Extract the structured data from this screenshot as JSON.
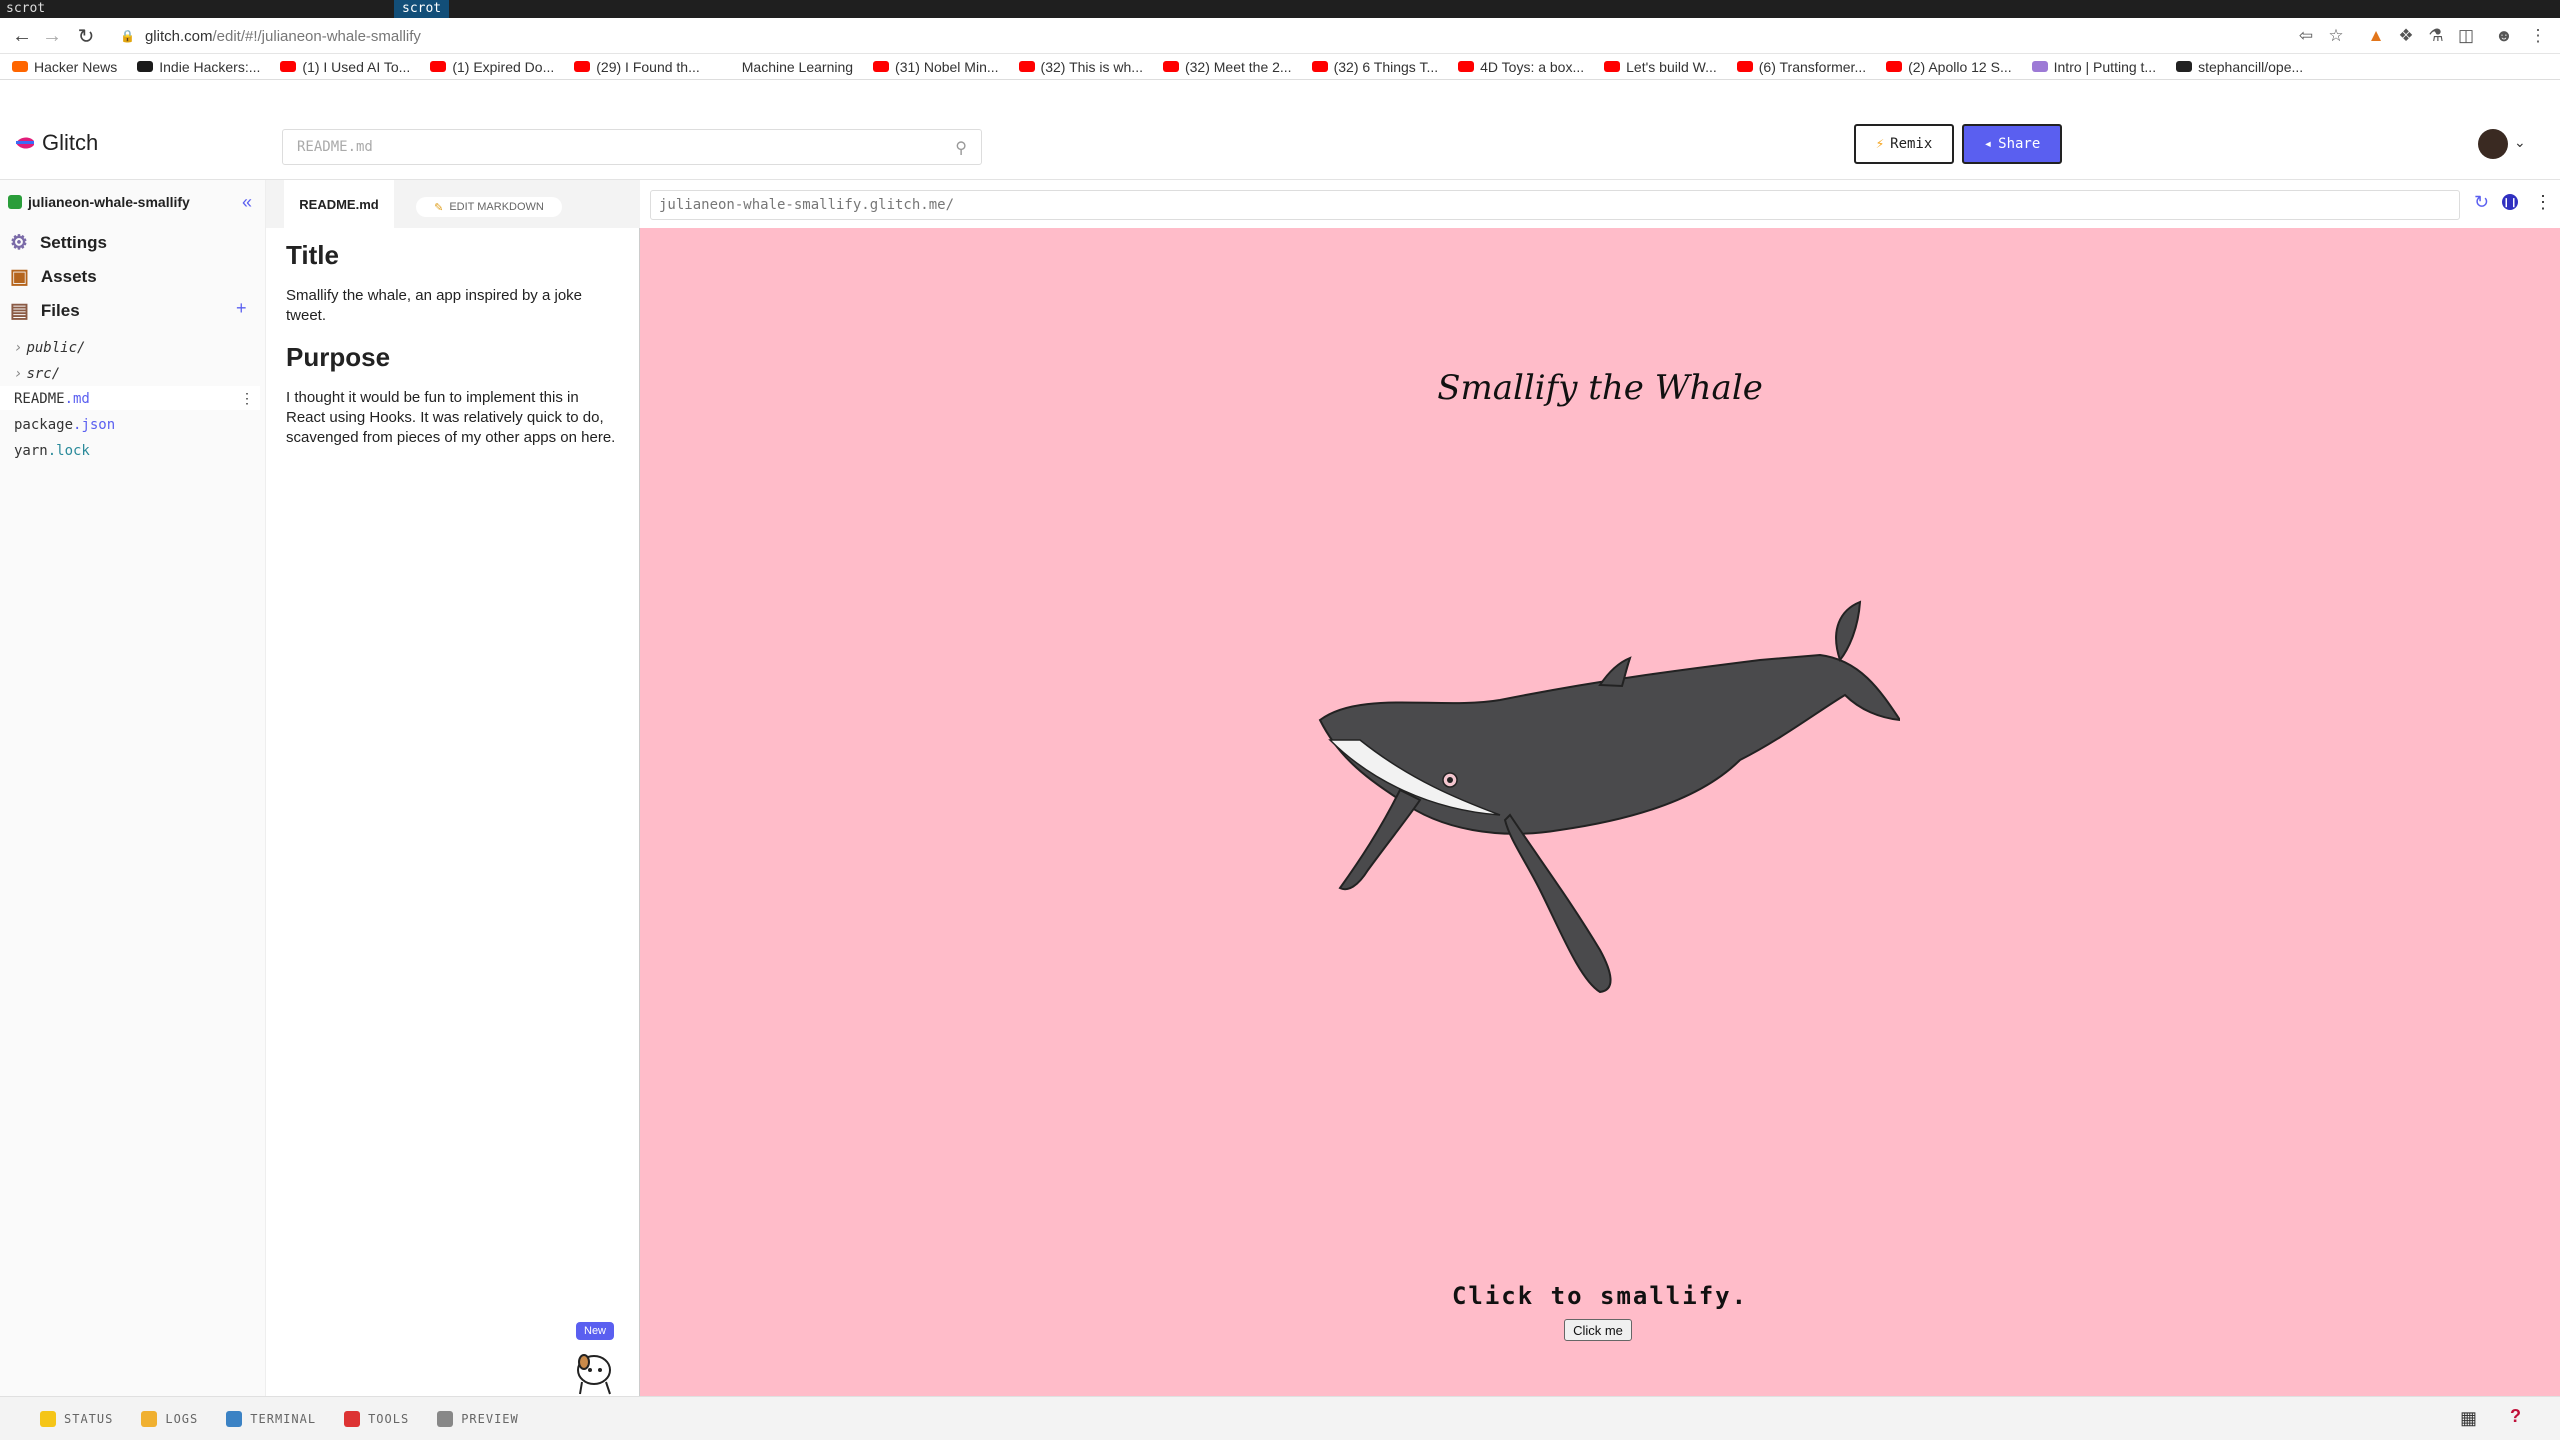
{
  "terminal": {
    "text": "scrot",
    "active_tab": "scrot"
  },
  "browser": {
    "url_host": "glitch.com",
    "url_path": "/edit/#!/julianeon-whale-smallify",
    "bookmarks": [
      {
        "label": "Hacker News",
        "icon": "hn-icon",
        "color": "#ff6600"
      },
      {
        "label": "Indie Hackers:...",
        "icon": "ih-icon",
        "color": "#1b1b1b"
      },
      {
        "label": "(1) I Used AI To...",
        "icon": "youtube-icon",
        "color": "#ff0000"
      },
      {
        "label": "(1) Expired Do...",
        "icon": "youtube-icon",
        "color": "#ff0000"
      },
      {
        "label": "(29) I Found th...",
        "icon": "youtube-icon",
        "color": "#ff0000"
      },
      {
        "label": "Machine Learning",
        "icon": "folder-icon",
        "color": "#ffffff"
      },
      {
        "label": "(31) Nobel Min...",
        "icon": "youtube-icon",
        "color": "#ff0000"
      },
      {
        "label": "(32) This is wh...",
        "icon": "youtube-icon",
        "color": "#ff0000"
      },
      {
        "label": "(32) Meet the 2...",
        "icon": "youtube-icon",
        "color": "#ff0000"
      },
      {
        "label": "(32) 6 Things T...",
        "icon": "youtube-icon",
        "color": "#ff0000"
      },
      {
        "label": "4D Toys: a box...",
        "icon": "youtube-icon",
        "color": "#ff0000"
      },
      {
        "label": "Let's build W...",
        "icon": "youtube-icon",
        "color": "#ff0000"
      },
      {
        "label": "(6) Transformer...",
        "icon": "youtube-icon",
        "color": "#ff0000"
      },
      {
        "label": "(2) Apollo 12 S...",
        "icon": "youtube-icon",
        "color": "#ff0000"
      },
      {
        "label": "Intro | Putting t...",
        "icon": "globe-icon",
        "color": "#9d7ad6"
      },
      {
        "label": "stephancill/ope...",
        "icon": "github-icon",
        "color": "#222222"
      }
    ]
  },
  "header": {
    "logo": "Glitch",
    "search_placeholder": "README.md",
    "remix_label": "Remix",
    "share_label": "Share",
    "accent": "#5a5ff0"
  },
  "sidebar": {
    "project_name": "julianeon-whale-smallify",
    "items": [
      {
        "label": "Settings"
      },
      {
        "label": "Assets"
      },
      {
        "label": "Files"
      }
    ],
    "folders": [
      "public/",
      "src/"
    ],
    "files": [
      {
        "name": "README",
        "ext": ".md"
      },
      {
        "name": "package",
        "ext": ".json"
      },
      {
        "name": "yarn",
        "ext": ".lock"
      }
    ],
    "new_badge": "New"
  },
  "readme": {
    "tab_label": "README.md",
    "edit_label": "EDIT MARKDOWN",
    "h_title": "Title",
    "p_title": "Smallify the whale, an app inspired by a joke tweet.",
    "h_purpose": "Purpose",
    "p_purpose": "I thought it would be fun to implement this in React using Hooks. It was relatively quick to do, scavenged from pieces of my other apps on here."
  },
  "preview": {
    "url_text": "julianeon-whale-smallify.glitch.me/",
    "app_title": "Smallify the Whale",
    "prompt": "Click to smallify.",
    "button_label": "Click me",
    "background": "#ffbcc9"
  },
  "statusbar": {
    "items": [
      {
        "label": "STATUS",
        "color": "#f5c518"
      },
      {
        "label": "LOGS",
        "color": "#f0b030"
      },
      {
        "label": "TERMINAL",
        "color": "#3b82c4"
      },
      {
        "label": "TOOLS",
        "color": "#d33"
      },
      {
        "label": "PREVIEW",
        "color": "#888"
      }
    ]
  }
}
